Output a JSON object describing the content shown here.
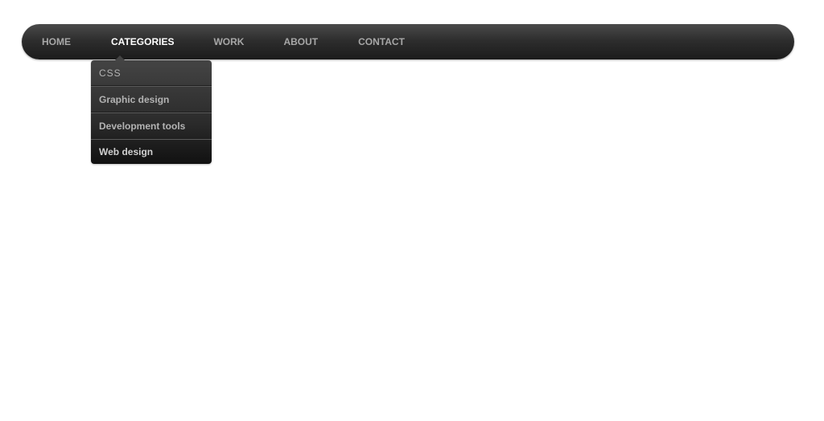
{
  "nav": {
    "items": [
      {
        "label": "HOME"
      },
      {
        "label": "CATEGORIES",
        "active": true
      },
      {
        "label": "WORK"
      },
      {
        "label": "ABOUT"
      },
      {
        "label": "CONTACT"
      }
    ]
  },
  "dropdown": {
    "items": [
      {
        "label": "CSS"
      },
      {
        "label": "Graphic design"
      },
      {
        "label": "Development tools"
      },
      {
        "label": "Web design"
      }
    ]
  },
  "colors": {
    "bar_top": "#4a4a4a",
    "bar_bottom": "#1b1b1b",
    "text_inactive": "#a7a7a7",
    "text_active": "#ffffff"
  }
}
